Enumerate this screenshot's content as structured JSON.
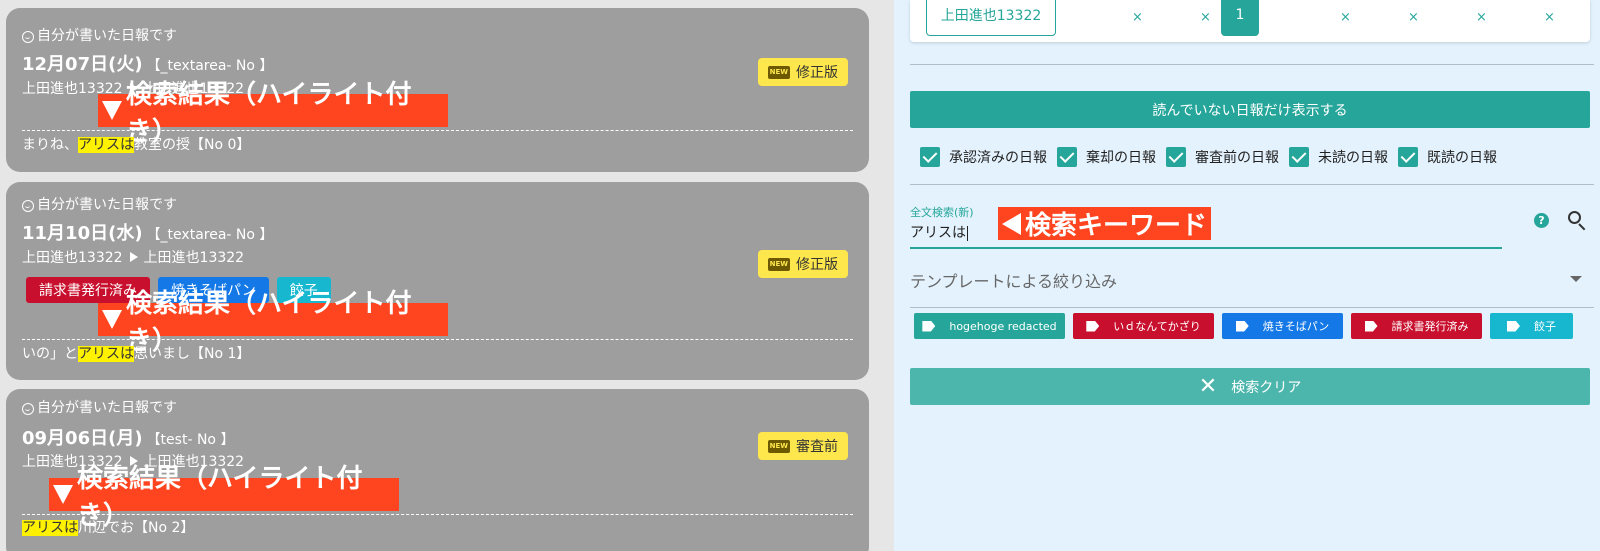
{
  "reports": [
    {
      "mine_label": "自分が書いた日報です",
      "date": "12月07日(火)",
      "tag": "【_textarea- No 】",
      "from": "上田進也13322",
      "to": "上田進也13322",
      "status_badge": "NEW",
      "status": "修正版",
      "annotation": "検索結果（ハイライト付き）",
      "excerpt_before": "まりね、",
      "excerpt_highlight": "アリスは",
      "excerpt_after": "教室の授【No 0】",
      "labels": []
    },
    {
      "mine_label": "自分が書いた日報です",
      "date": "11月10日(水)",
      "tag": "【_textarea- No 】",
      "from": "上田進也13322",
      "to": "上田進也13322",
      "status_badge": "NEW",
      "status": "修正版",
      "annotation": "検索結果（ハイライト付き）",
      "excerpt_before": "いの」と",
      "excerpt_highlight": "アリスは",
      "excerpt_after": "思いまし【No 1】",
      "labels": [
        {
          "text": "請求書発行済み",
          "color": "#c8102e"
        },
        {
          "text": "焼きそばパン",
          "color": "#1479e6"
        },
        {
          "text": "餃子",
          "color": "#17b7d0"
        }
      ]
    },
    {
      "mine_label": "自分が書いた日報です",
      "date": "09月06日(月)",
      "tag": "【test- No 】",
      "from": "上田進也13322",
      "to": "上田進也13322",
      "status_badge": "NEW",
      "status": "審査前",
      "annotation": "検索結果（ハイライト付き）",
      "excerpt_before": "",
      "excerpt_highlight": "アリスは",
      "excerpt_after": "川辺でお【No 2】",
      "labels": []
    }
  ],
  "pager": {
    "current_user": "上田進也13322",
    "x_marks": [
      "×",
      "×",
      "×",
      "×",
      "×",
      "×"
    ],
    "page": "1"
  },
  "unread_button": "読んでいない日報だけ表示する",
  "checkboxes": [
    {
      "label": "承認済みの日報",
      "checked": true
    },
    {
      "label": "棄却の日報",
      "checked": true
    },
    {
      "label": "審査前の日報",
      "checked": true
    },
    {
      "label": "未読の日報",
      "checked": true
    },
    {
      "label": "既読の日報",
      "checked": true
    }
  ],
  "search": {
    "label": "全文検索(新)",
    "value": "アリスは",
    "annotation": "検索キーワード",
    "help": "?"
  },
  "template_filter": "テンプレートによる絞り込み",
  "tag_chips": [
    {
      "text": "hogehoge redacted",
      "color": "#26a69a"
    },
    {
      "text": "いｄなんてかざり",
      "color": "#c8102e"
    },
    {
      "text": "焼きそばパン",
      "color": "#1479e6"
    },
    {
      "text": "請求書発行済み",
      "color": "#c8102e"
    },
    {
      "text": "餃子",
      "color": "#17b7d0"
    }
  ],
  "clear_button": "検索クリア",
  "colors": {
    "accent": "#26a69a",
    "annotation": "#ff4520",
    "highlight": "#fff200",
    "badge": "#fde74c"
  }
}
